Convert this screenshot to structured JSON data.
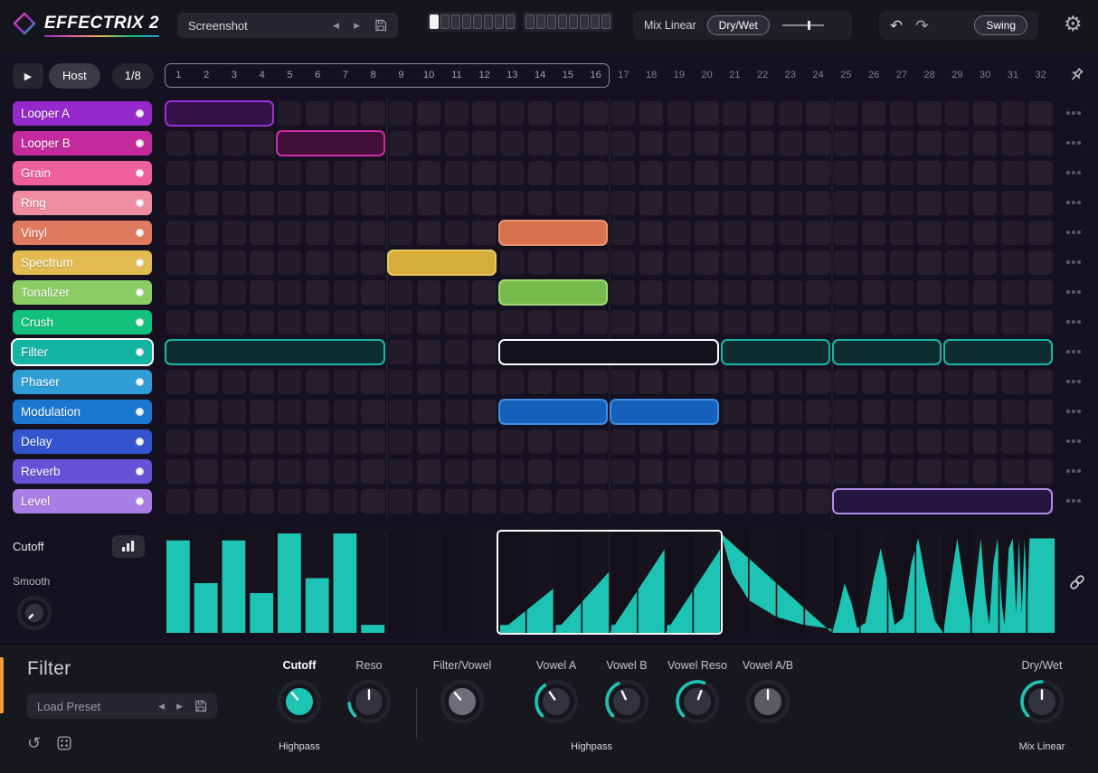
{
  "app": {
    "title": "EFFECTRIX 2"
  },
  "topbar": {
    "preset_name": "Screenshot",
    "pattern_squares": 16,
    "active_pattern": 1,
    "mix_mode_label": "Mix Linear",
    "drywet_label": "Dry/Wet",
    "swing_label": "Swing"
  },
  "transport": {
    "host_label": "Host",
    "rate_label": "1/8"
  },
  "sequencer": {
    "columns": 32,
    "loop_columns": 16,
    "group_size": 8,
    "tracks": [
      {
        "label": "Looper A",
        "color": "#9529cb"
      },
      {
        "label": "Looper B",
        "color": "#c42a9d"
      },
      {
        "label": "Grain",
        "color": "#ef5f9c"
      },
      {
        "label": "Ring",
        "color": "#f18da2"
      },
      {
        "label": "Vinyl",
        "color": "#e07a5f"
      },
      {
        "label": "Spectrum",
        "color": "#e2bb51"
      },
      {
        "label": "Tonalizer",
        "color": "#8ccd63"
      },
      {
        "label": "Crush",
        "color": "#12c17d"
      },
      {
        "label": "Filter",
        "color": "#14b4a5",
        "selected": true
      },
      {
        "label": "Phaser",
        "color": "#2f9ed7"
      },
      {
        "label": "Modulation",
        "color": "#1b78d1"
      },
      {
        "label": "Delay",
        "color": "#3354ce"
      },
      {
        "label": "Reverb",
        "color": "#6652d7"
      },
      {
        "label": "Level",
        "color": "#a87de5"
      }
    ],
    "blocks": [
      {
        "row": 0,
        "start": 1,
        "len": 4,
        "fill": "#33124a",
        "border": "#9a30d6"
      },
      {
        "row": 1,
        "start": 5,
        "len": 4,
        "fill": "#41103a",
        "border": "#cf2da6"
      },
      {
        "row": 4,
        "start": 13,
        "len": 4,
        "fill": "#d8714f",
        "border": "#eb9271"
      },
      {
        "row": 5,
        "start": 9,
        "len": 4,
        "fill": "#d6ad3c",
        "border": "#ecca5f"
      },
      {
        "row": 6,
        "start": 13,
        "len": 4,
        "fill": "#77bb4c",
        "border": "#a0da75"
      },
      {
        "row": 8,
        "start": 1,
        "len": 8,
        "fill": "#0e2d30",
        "border": "#17b7a7"
      },
      {
        "row": 8,
        "start": 13,
        "len": 8,
        "fill": "#14111c",
        "border": "#ffffff",
        "selected": true
      },
      {
        "row": 8,
        "start": 21,
        "len": 4,
        "fill": "#0e2d30",
        "border": "#17b7a7"
      },
      {
        "row": 8,
        "start": 25,
        "len": 4,
        "fill": "#0e2d30",
        "border": "#17b7a7"
      },
      {
        "row": 8,
        "start": 29,
        "len": 4,
        "fill": "#0e2d30",
        "border": "#17b7a7"
      },
      {
        "row": 10,
        "start": 13,
        "len": 4,
        "fill": "#1560bb",
        "border": "#3f8fe2"
      },
      {
        "row": 10,
        "start": 17,
        "len": 4,
        "fill": "#1560bb",
        "border": "#3f8fe2"
      },
      {
        "row": 13,
        "start": 25,
        "len": 8,
        "fill": "#241640",
        "border": "#b68bee"
      }
    ]
  },
  "value_lane": {
    "color": "#1dc3b3",
    "selected_region": {
      "start": 13,
      "len": 8
    },
    "bars": [
      {
        "col": 1,
        "h": 0.93
      },
      {
        "col": 2,
        "h": 0.5
      },
      {
        "col": 3,
        "h": 0.93
      },
      {
        "col": 4,
        "h": 0.4
      },
      {
        "col": 5,
        "h": 1.0
      },
      {
        "col": 6,
        "h": 0.55
      },
      {
        "col": 7,
        "h": 1.0
      },
      {
        "col": 8,
        "h": 0.08
      },
      {
        "col": 13,
        "h": 0.08
      },
      {
        "col": 14,
        "h": 0.08
      },
      {
        "col": 15,
        "h": 0.08
      },
      {
        "col": 16,
        "h": 0.08
      },
      {
        "col": 17,
        "h": 0.08
      },
      {
        "col": 18,
        "h": 0.08
      },
      {
        "col": 19,
        "h": 0.08
      },
      {
        "col": 20,
        "h": 0.08
      }
    ],
    "shapes": [
      {
        "name": "saw-ramps",
        "points": [
          [
            12,
            0
          ],
          [
            14,
            0.45
          ],
          [
            14,
            0
          ],
          [
            16,
            0.62
          ],
          [
            16,
            0
          ],
          [
            18,
            0.85
          ],
          [
            18,
            0
          ],
          [
            20,
            0.85
          ],
          [
            20,
            0
          ]
        ]
      },
      {
        "name": "decay",
        "points": [
          [
            20,
            1
          ],
          [
            20.4,
            0.6
          ],
          [
            21,
            0.33
          ],
          [
            22,
            0.16
          ],
          [
            23,
            0.08
          ],
          [
            24,
            0.04
          ],
          [
            24,
            0
          ]
        ]
      },
      {
        "name": "bumps",
        "points": [
          [
            24,
            0
          ],
          [
            24.2,
            0.2
          ],
          [
            24.45,
            0.5
          ],
          [
            24.7,
            0.3
          ],
          [
            24.9,
            0.05
          ],
          [
            25.2,
            0.1
          ],
          [
            25.5,
            0.55
          ],
          [
            25.75,
            0.85
          ],
          [
            26,
            0.5
          ],
          [
            26.25,
            0.08
          ],
          [
            26.55,
            0.15
          ],
          [
            26.85,
            0.7
          ],
          [
            27.1,
            0.95
          ],
          [
            27.4,
            0.5
          ],
          [
            27.7,
            0.12
          ],
          [
            28,
            0
          ]
        ]
      },
      {
        "name": "spikes",
        "points": [
          [
            28,
            0
          ],
          [
            28.2,
            0.4
          ],
          [
            28.5,
            0.95
          ],
          [
            28.8,
            0.4
          ],
          [
            29,
            0.08
          ],
          [
            29.2,
            0.6
          ],
          [
            29.35,
            0.95
          ],
          [
            29.5,
            0.4
          ],
          [
            29.65,
            0.08
          ],
          [
            29.8,
            0.7
          ],
          [
            29.95,
            0.95
          ],
          [
            30.1,
            0.3
          ],
          [
            30.2,
            0.08
          ],
          [
            30.35,
            0.85
          ],
          [
            30.5,
            0.95
          ],
          [
            30.62,
            0.2
          ],
          [
            30.72,
            0.95
          ],
          [
            30.82,
            0.2
          ],
          [
            30.92,
            0.95
          ],
          [
            31.02,
            0.3
          ],
          [
            31.1,
            0.95
          ],
          [
            32,
            0.95
          ],
          [
            32,
            0
          ]
        ]
      }
    ]
  },
  "left_panel": {
    "param_label": "Cutoff",
    "smooth_label": "Smooth"
  },
  "bottom_panel": {
    "title": "Filter",
    "preset_placeholder": "Load Preset",
    "knobs": [
      {
        "label": "Cutoff",
        "pointer": -40,
        "arc": null,
        "knob_color": "#1dc3b3",
        "bold": true
      },
      {
        "label": "Reso",
        "pointer": 0,
        "arc": [
          -135,
          -95
        ]
      },
      {
        "label": "Filter/Vowel",
        "pointer": -40,
        "arc": null,
        "knob_color": "#6e6e78"
      },
      {
        "label": "Vowel A",
        "pointer": -35,
        "arc": [
          -135,
          -35
        ]
      },
      {
        "label": "Vowel B",
        "pointer": -25,
        "arc": [
          -135,
          -25
        ]
      },
      {
        "label": "Vowel Reso",
        "pointer": 20,
        "arc": [
          -135,
          20
        ]
      },
      {
        "label": "Vowel A/B",
        "pointer": 0,
        "arc": null,
        "knob_color": "#5b5b64"
      },
      {
        "label": "Dry/Wet",
        "pointer": 0,
        "arc": [
          -135,
          0
        ]
      }
    ],
    "sub_labels": [
      "Highpass",
      "Highpass",
      "Mix Linear"
    ]
  }
}
